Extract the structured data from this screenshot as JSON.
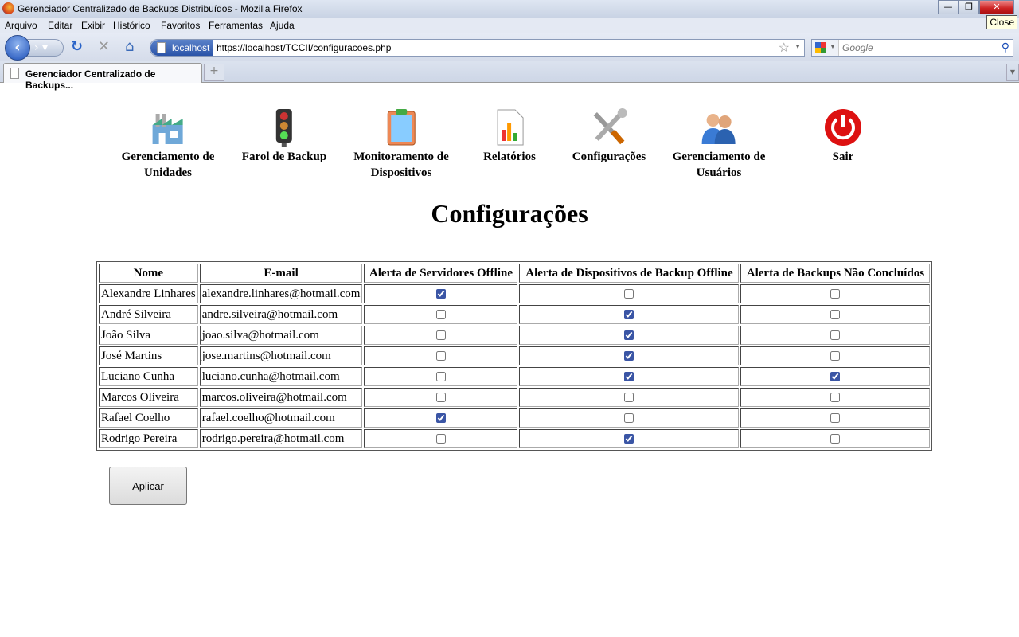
{
  "window": {
    "title": "Gerenciador Centralizado de Backups Distribuídos - Mozilla Firefox",
    "tooltip": "Close"
  },
  "menu": [
    "Arquivo",
    "Editar",
    "Exibir",
    "Histórico",
    "Favoritos",
    "Ferramentas",
    "Ajuda"
  ],
  "address": {
    "identity": "localhost",
    "url": "https://localhost/TCCII/configuracoes.php"
  },
  "search": {
    "placeholder": "Google"
  },
  "tab": {
    "label": "Gerenciador Centralizado de Backups...",
    "new_tab": "+"
  },
  "nav": [
    {
      "line1": "Gerenciamento de",
      "line2": "Unidades",
      "icon": "factory-icon"
    },
    {
      "line1": "Farol de Backup",
      "line2": "",
      "icon": "traffic-light-icon"
    },
    {
      "line1": "Monitoramento de",
      "line2": "Dispositivos",
      "icon": "clipboard-icon"
    },
    {
      "line1": "Relatórios",
      "line2": "",
      "icon": "report-chart-icon"
    },
    {
      "line1": "Configurações",
      "line2": "",
      "icon": "tools-icon"
    },
    {
      "line1": "Gerenciamento de",
      "line2": "Usuários",
      "icon": "users-icon"
    },
    {
      "line1": "Sair",
      "line2": "",
      "icon": "power-icon"
    }
  ],
  "page_title": "Configurações",
  "table": {
    "headers": [
      "Nome",
      "E-mail",
      "Alerta de Servidores Offline",
      "Alerta de Dispositivos de Backup Offline",
      "Alerta de Backups Não Concluídos"
    ],
    "rows": [
      {
        "name": "Alexandre Linhares",
        "email": "alexandre.linhares@hotmail.com",
        "checks": [
          true,
          false,
          false
        ]
      },
      {
        "name": "André Silveira",
        "email": "andre.silveira@hotmail.com",
        "checks": [
          false,
          true,
          false
        ]
      },
      {
        "name": "João Silva",
        "email": "joao.silva@hotmail.com",
        "checks": [
          false,
          true,
          false
        ]
      },
      {
        "name": "José Martins",
        "email": "jose.martins@hotmail.com",
        "checks": [
          false,
          true,
          false
        ]
      },
      {
        "name": "Luciano Cunha",
        "email": "luciano.cunha@hotmail.com",
        "checks": [
          false,
          true,
          true
        ]
      },
      {
        "name": "Marcos Oliveira",
        "email": "marcos.oliveira@hotmail.com",
        "checks": [
          false,
          false,
          false
        ]
      },
      {
        "name": "Rafael Coelho",
        "email": "rafael.coelho@hotmail.com",
        "checks": [
          true,
          false,
          false
        ]
      },
      {
        "name": "Rodrigo Pereira",
        "email": "rodrigo.pereira@hotmail.com",
        "checks": [
          false,
          true,
          false
        ]
      }
    ]
  },
  "apply_label": "Aplicar"
}
